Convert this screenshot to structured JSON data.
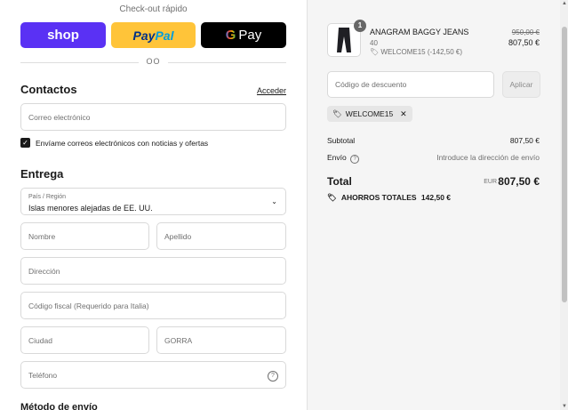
{
  "express": {
    "title": "Check-out rápido",
    "shop_label": "shop",
    "paypal_part1": "Pay",
    "paypal_part2": "Pal",
    "gpay_g": "G",
    "gpay_label": "Pay",
    "or_label": "OO"
  },
  "contact": {
    "heading": "Contactos",
    "login_link": "Acceder",
    "email_placeholder": "Correo electrónico",
    "newsletter_checked": true,
    "newsletter_label": "Envíame correos electrónicos con noticias y ofertas"
  },
  "delivery": {
    "heading": "Entrega",
    "country_label": "País / Región",
    "country_value": "Islas menores alejadas de EE. UU.",
    "first_name_placeholder": "Nombre",
    "last_name_placeholder": "Apellido",
    "address_placeholder": "Dirección",
    "tax_code_placeholder": "Código fiscal (Requerido para Italia)",
    "city_placeholder": "Ciudad",
    "state_placeholder": "GORRA",
    "phone_placeholder": "Teléfono"
  },
  "shipping_method": {
    "heading": "Método de envío"
  },
  "cart": {
    "item": {
      "quantity": "1",
      "name": "ANAGRAM BAGGY JEANS",
      "variant": "40",
      "discount_label": "WELCOME15 (-142,50 €)",
      "original_price": "950,00 €",
      "price": "807,50 €"
    },
    "discount": {
      "placeholder": "Código de descuento",
      "apply_label": "Aplicar",
      "applied_code": "WELCOME15"
    },
    "subtotal_label": "Subtotal",
    "subtotal_value": "807,50 €",
    "shipping_label": "Envío",
    "shipping_value": "Introduce la dirección de envío",
    "total_label": "Total",
    "total_currency": "EUR",
    "total_value": "807,50 €",
    "savings_label": "AHORROS TOTALES",
    "savings_value": "142,50 €"
  }
}
